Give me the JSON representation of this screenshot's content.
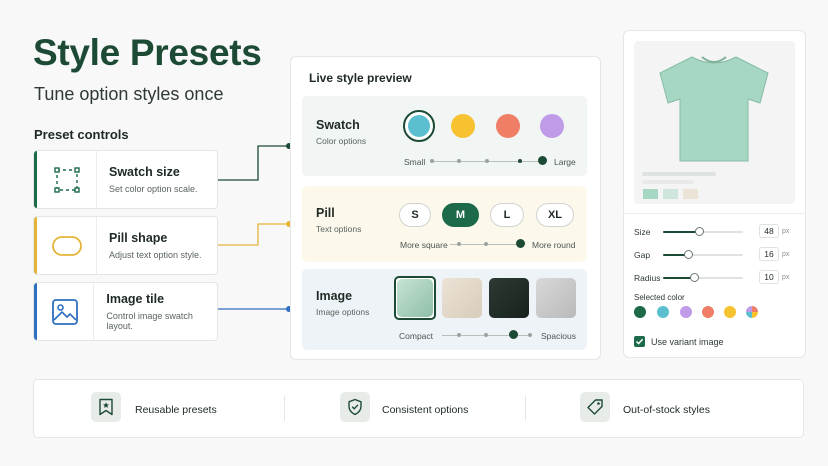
{
  "hero": {
    "title": "Style Presets",
    "subtitle": "Tune option styles once"
  },
  "controls": {
    "label": "Preset controls",
    "items": [
      {
        "title": "Swatch size",
        "desc": "Set color option scale.",
        "icon": "swatch-size-icon",
        "accent": "#1d6a4a"
      },
      {
        "title": "Pill shape",
        "desc": "Adjust text option style.",
        "icon": "pill-shape-icon",
        "accent": "#e5b53a"
      },
      {
        "title": "Image tile",
        "desc": "Control image swatch layout.",
        "icon": "image-tile-icon",
        "accent": "#2f6fc0"
      }
    ]
  },
  "preview": {
    "title": "Live style preview",
    "swatch": {
      "title": "Swatch",
      "subtitle": "Color options",
      "colors": [
        "#5bbfcf",
        "#f6c230",
        "#f07e67",
        "#c09be8"
      ],
      "selected_index": 0,
      "slider": {
        "min_label": "Small",
        "max_label": "Large",
        "value": 1.0
      }
    },
    "pill": {
      "title": "Pill",
      "subtitle": "Text options",
      "options": [
        "S",
        "M",
        "L",
        "XL"
      ],
      "selected_index": 1,
      "slider": {
        "min_label": "More square",
        "max_label": "More round",
        "value": 1.0
      }
    },
    "image": {
      "title": "Image",
      "subtitle": "Image options",
      "selected_index": 0,
      "slider": {
        "min_label": "Compact",
        "max_label": "Spacious",
        "value": 0.75
      }
    }
  },
  "settings": {
    "rows": [
      {
        "label": "Size",
        "value": "48",
        "unit": "px",
        "fraction": 0.45
      },
      {
        "label": "Gap",
        "value": "16",
        "unit": "px",
        "fraction": 0.3
      },
      {
        "label": "Radius",
        "value": "10",
        "unit": "px",
        "fraction": 0.4
      }
    ],
    "selected_color_label": "Selected color",
    "colors": [
      "#1d6a4a",
      "#5bbfcf",
      "#c09be8",
      "#f07e67",
      "#f6c230",
      "multicolor"
    ],
    "variant_label": "Use variant image",
    "variant_checked": true
  },
  "footer": {
    "items": [
      {
        "label": "Reusable presets",
        "icon": "bookmark-star-icon"
      },
      {
        "label": "Consistent options",
        "icon": "shield-check-icon"
      },
      {
        "label": "Out-of-stock styles",
        "icon": "tag-icon"
      }
    ]
  }
}
